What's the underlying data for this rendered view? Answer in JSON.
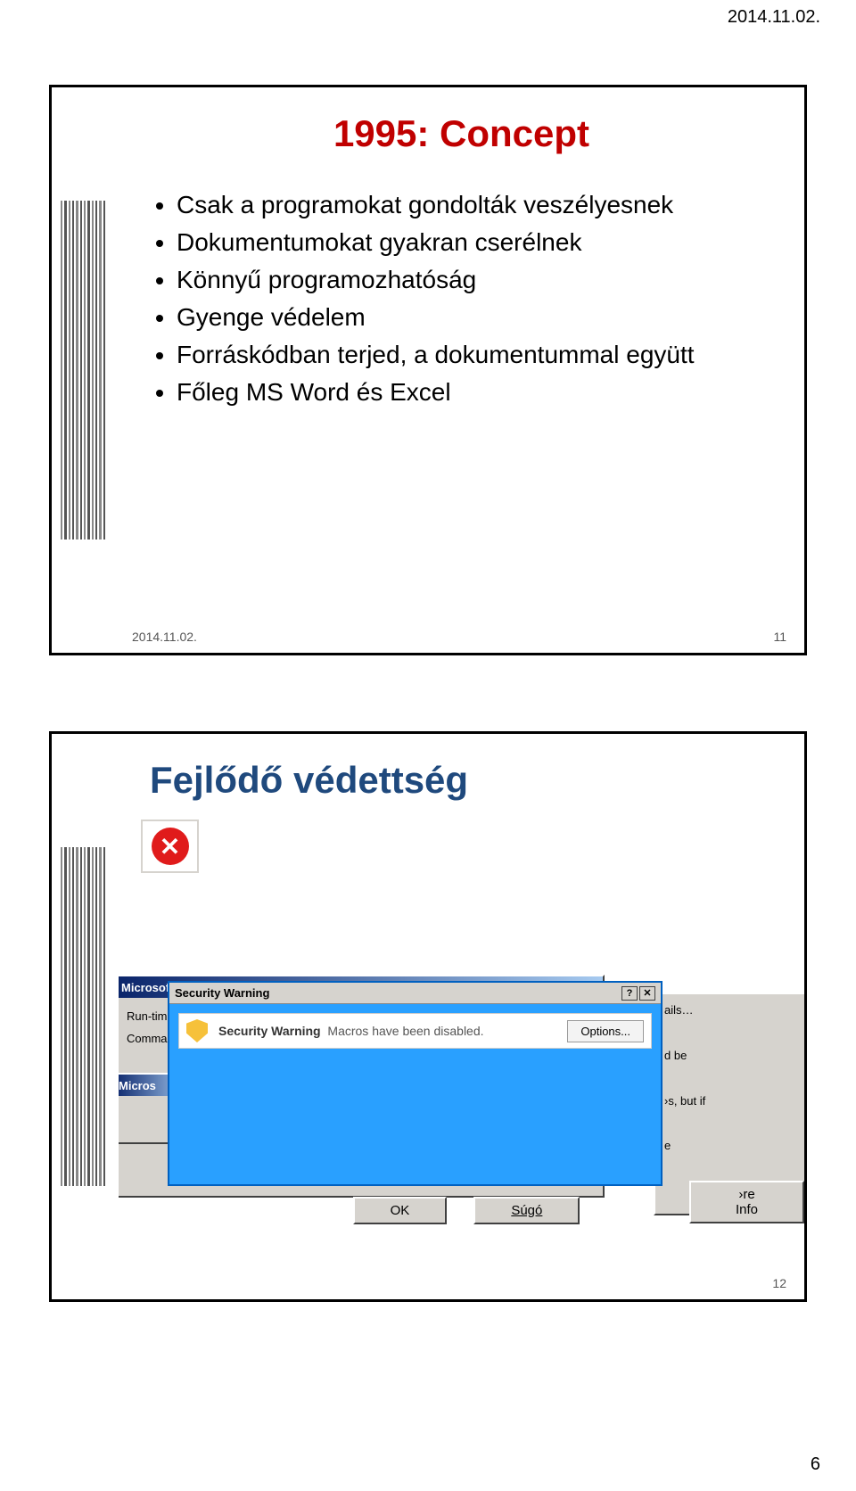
{
  "page": {
    "header_date": "2014.11.02.",
    "page_number": "6"
  },
  "slide1": {
    "title": "1995: Concept",
    "bullets": [
      "Csak a programokat gondolták veszélyesnek",
      "Dokumentumokat gyakran cserélnek",
      "Könnyű programozhatóság",
      "Gyenge védelem",
      "Forráskódban terjed, a dokumentummal együtt",
      "Főleg MS Word és Excel"
    ],
    "footer_date": "2014.11.02.",
    "slide_number": "11"
  },
  "slide2": {
    "title": "Fejlődő védettség",
    "dlg_back": {
      "title": "Microsoft \\",
      "line1": "Run-time e",
      "line2": "Command"
    },
    "dlg_micros": {
      "title": "Micros"
    },
    "security_dialog": {
      "title": "Security Warning",
      "message_bold": "Security Warning",
      "message": "Macros have been disabled.",
      "options_btn": "Options..."
    },
    "right_text": {
      "l1": "ails…",
      "l2": "d be",
      "l3": "›s, but if",
      "l4": "e"
    },
    "buttons": {
      "ok": "OK",
      "help": "Súgó",
      "more_info": "›re Info"
    },
    "slide_number": "12"
  }
}
